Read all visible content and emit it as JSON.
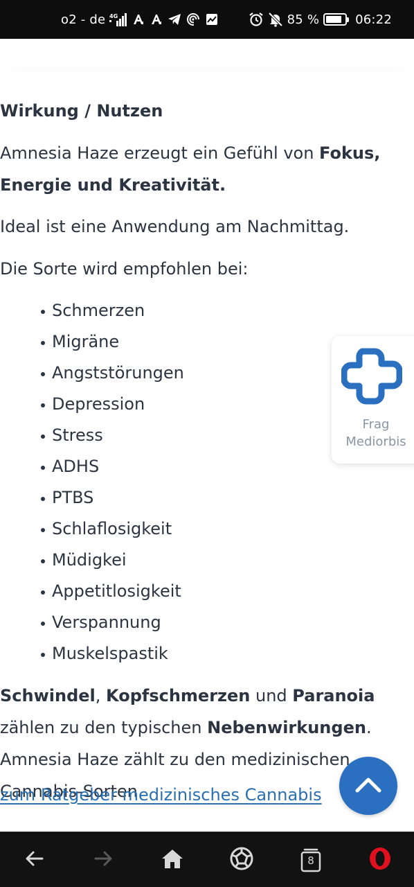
{
  "status_bar": {
    "carrier": "o2 - de",
    "network": "4G",
    "battery": "85 %",
    "battery_level": 0.85,
    "time": "06:22",
    "icons_left": [
      "signal-icon",
      "a-icon",
      "a-icon",
      "telegram-icon",
      "hotspot-icon",
      "chart-icon"
    ],
    "icons_right": [
      "alarm-icon",
      "bell-muted-icon",
      "battery-icon"
    ]
  },
  "article": {
    "section_heading": "Wirkung / Nutzen",
    "p1_start": "Amnesia Haze erzeugt ein Gefühl von ",
    "p1_bold": "Fokus, Energie und Kreativität.",
    "p2": "Ideal ist eine Anwendung am Nachmittag.",
    "p3": "Die Sorte wird empfohlen bei:",
    "symptoms": [
      "Schmerzen",
      "Migräne",
      "Angststörungen",
      "Depression",
      "Stress",
      "ADHS",
      "PTBS",
      "Schlaflosigkeit",
      "Müdigkei",
      "Appetitlosigkeit",
      "Verspannung",
      "Muskelspastik"
    ],
    "p4": {
      "b1": "Schwindel",
      "t1": ", ",
      "b2": "Kopfschmerzen",
      "t2": " und ",
      "b3": "Paranoia",
      "t3": " zählen zu den typischen ",
      "b4": "Nebenwirkungen",
      "t4": ". Amnesia Haze zählt zu den medizinischen Cannabis-Sorten."
    },
    "link_text": "zum Ratgeber medizinisches Cannabis"
  },
  "widget": {
    "line1": "Frag",
    "line2": "Mediorbis",
    "icon": "mediorbis-logo-icon",
    "color": "#2a6fc0"
  },
  "scroll_top": {
    "icon": "chevron-up-icon",
    "color": "#2a6fc0"
  },
  "navbar": {
    "tab_count": "8",
    "buttons": [
      "back-icon",
      "forward-icon",
      "home-icon",
      "speed-dial-icon",
      "tabs-icon",
      "opera-menu-icon"
    ],
    "accent": "#e0101e"
  }
}
